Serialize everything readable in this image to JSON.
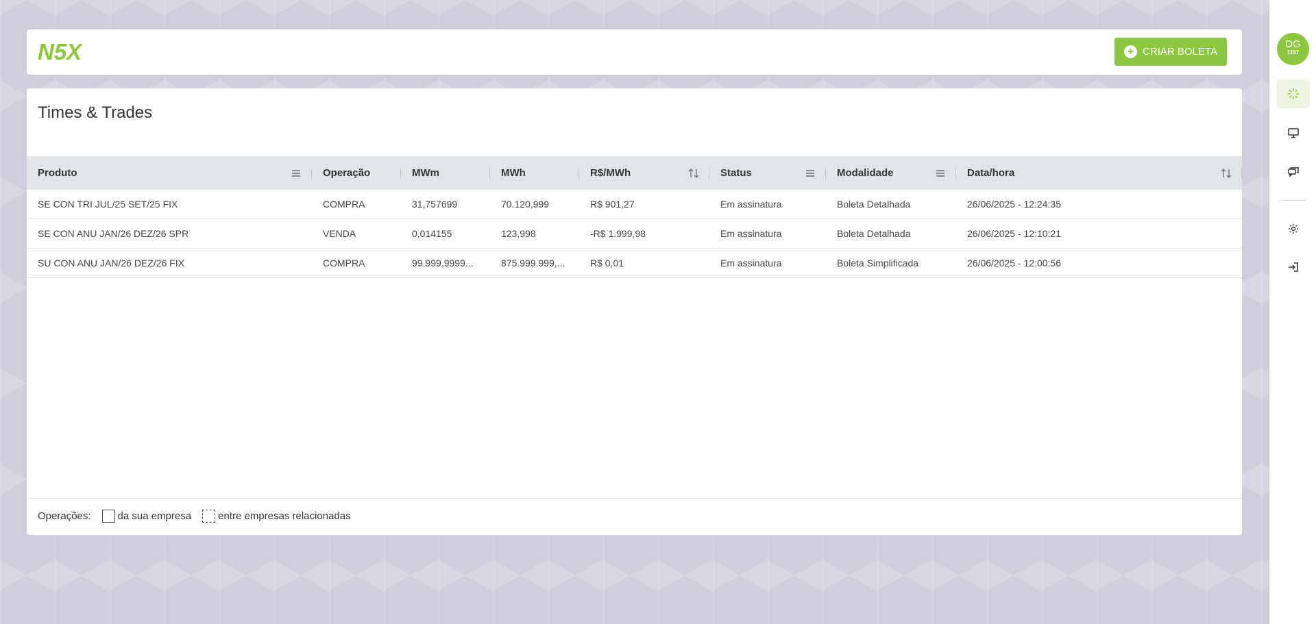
{
  "header": {
    "logo_text": "N5X",
    "create_button_label": "CRIAR BOLETA"
  },
  "user": {
    "initials": "DG",
    "code": "1157"
  },
  "rail": {
    "icons": [
      "spinner-icon",
      "monitor-icon",
      "chat-icon",
      "gear-icon",
      "logout-icon"
    ]
  },
  "page": {
    "title": "Times & Trades"
  },
  "table": {
    "columns": [
      "Produto",
      "Operação",
      "MWm",
      "MWh",
      "R$/MWh",
      "Status",
      "Modalidade",
      "Data/hora"
    ],
    "rows": [
      [
        "SE CON TRI JUL/25 SET/25 FIX",
        "COMPRA",
        "31,757699",
        "70.120,999",
        "R$ 901,27",
        "Em assinatura",
        "Boleta Detalhada",
        "26/06/2025 - 12:24:35"
      ],
      [
        "SE CON ANU JAN/26 DEZ/26 SPR",
        "VENDA",
        "0,014155",
        "123,998",
        "-R$ 1.999,98",
        "Em assinatura",
        "Boleta Detalhada",
        "26/06/2025 - 12:10:21"
      ],
      [
        "SU CON ANU JAN/26 DEZ/26 FIX",
        "COMPRA",
        "99.999,9999...",
        "875.999.999,...",
        "R$ 0,01",
        "Em assinatura",
        "Boleta Simplificada",
        "26/06/2025 - 12:00:56"
      ]
    ]
  },
  "legend": {
    "label": "Operações:",
    "own_company": "da sua empresa",
    "related_companies": "entre empresas relacionadas"
  },
  "colors": {
    "accent": "#8dc63f",
    "header_bg": "#e2e5e8",
    "page_bg": "#cfcfdb"
  }
}
